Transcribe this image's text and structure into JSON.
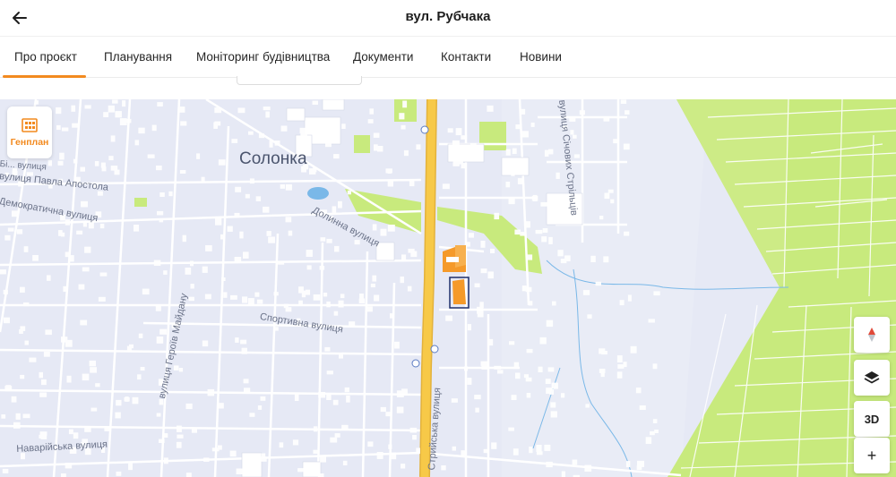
{
  "header": {
    "title": "вул. Рубчака",
    "back_icon": "arrow-left-icon"
  },
  "tabs": [
    {
      "label": "Про проєкт",
      "active": true
    },
    {
      "label": "Планування"
    },
    {
      "label": "Моніторинг будівництва"
    },
    {
      "label": "Документи"
    },
    {
      "label": "Контакти"
    },
    {
      "label": "Новини"
    }
  ],
  "map": {
    "labels": {
      "district": "Солонка",
      "street_apostola": "вулиця Павла Апостола",
      "street_demokratychna": "Демократична вулиця",
      "street_dolynna": "Долинна вулиця",
      "street_sportyvna": "Спортивна вулиця",
      "street_heroiv_maidanu": "вулиця Героїв Майдану",
      "street_navariiska": "Наварійська вулиця",
      "street_stryiska": "Стрийська вулиця",
      "street_sichovykh_striltsiv": "вулиця Січових Стрільців",
      "street_left_edge": "Бі... вулиця"
    },
    "genplan_label": "Генплан",
    "controls": {
      "compass_icon": "compass-icon",
      "layers_icon": "layers-icon",
      "view_3d_label": "3D",
      "zoom_in_label": "+"
    },
    "colors": {
      "land": "#e6e9f5",
      "roads": "#ffffff",
      "main_road": "#f7c948",
      "fields": "#c8ea7d",
      "water": "#7ab8e8",
      "project_building": "#f59a2a",
      "project_outline": "#1f2f6b"
    }
  }
}
